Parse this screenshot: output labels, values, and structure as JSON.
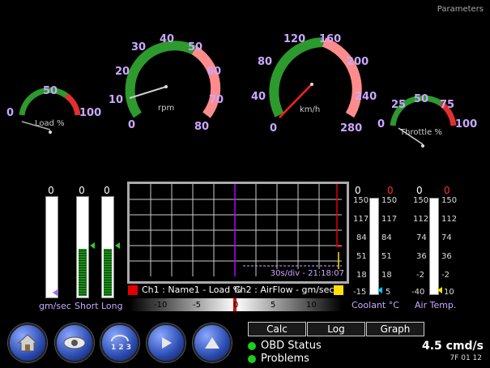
{
  "window": {
    "parameters_label": "Parameters"
  },
  "gauges": {
    "load": {
      "labels": [
        "0",
        "50",
        "100"
      ],
      "caption": "Load %"
    },
    "rpm": {
      "labels": [
        "0",
        "10",
        "20",
        "30",
        "40",
        "50",
        "60",
        "70",
        "80"
      ],
      "caption": "rpm"
    },
    "speed": {
      "labels": [
        "0",
        "40",
        "80",
        "120",
        "160",
        "200",
        "240",
        "280"
      ],
      "caption": "km/h"
    },
    "throttle": {
      "labels": [
        "0",
        "25",
        "50",
        "75",
        "100"
      ],
      "caption": "Throttle %"
    }
  },
  "bars": {
    "maf": {
      "value": "0",
      "label": "gm/sec"
    },
    "short": {
      "value": "0",
      "label": "Short"
    },
    "long": {
      "value": "0",
      "label": "Long"
    }
  },
  "graph": {
    "timebase": "30s/div - 21:18:07",
    "ch1_legend": "Ch1 : Name1 - Load %",
    "ch2_legend": "Ch2 : AirFlow - gm/sec",
    "ch1_color": "#e00000",
    "ch2_color": "#ffe000",
    "scale_ticks": [
      "-10",
      "-5",
      "0",
      "5",
      "10"
    ]
  },
  "coolant": {
    "value_left": "0",
    "value_right": "0",
    "ticks_left": [
      "150",
      "117",
      "84",
      "51",
      "18",
      "-15"
    ],
    "ticks_right": [
      "150",
      "117",
      "84",
      "51",
      "18",
      "5"
    ],
    "label": "Coolant °C"
  },
  "airtemp": {
    "value_left": "0",
    "value_right": "0",
    "ticks_left": [
      "150",
      "112",
      "74",
      "36",
      "-2",
      "-40"
    ],
    "ticks_right": [
      "150",
      "112",
      "74",
      "36",
      "-2",
      "10"
    ],
    "label": "Air Temp."
  },
  "tabs": {
    "calc": "Calc",
    "log": "Log",
    "graph": "Graph"
  },
  "status": {
    "obd": "OBD Status",
    "problems": "Problems",
    "rate": "4.5 cmd/s",
    "code": "7F 01 12"
  }
}
